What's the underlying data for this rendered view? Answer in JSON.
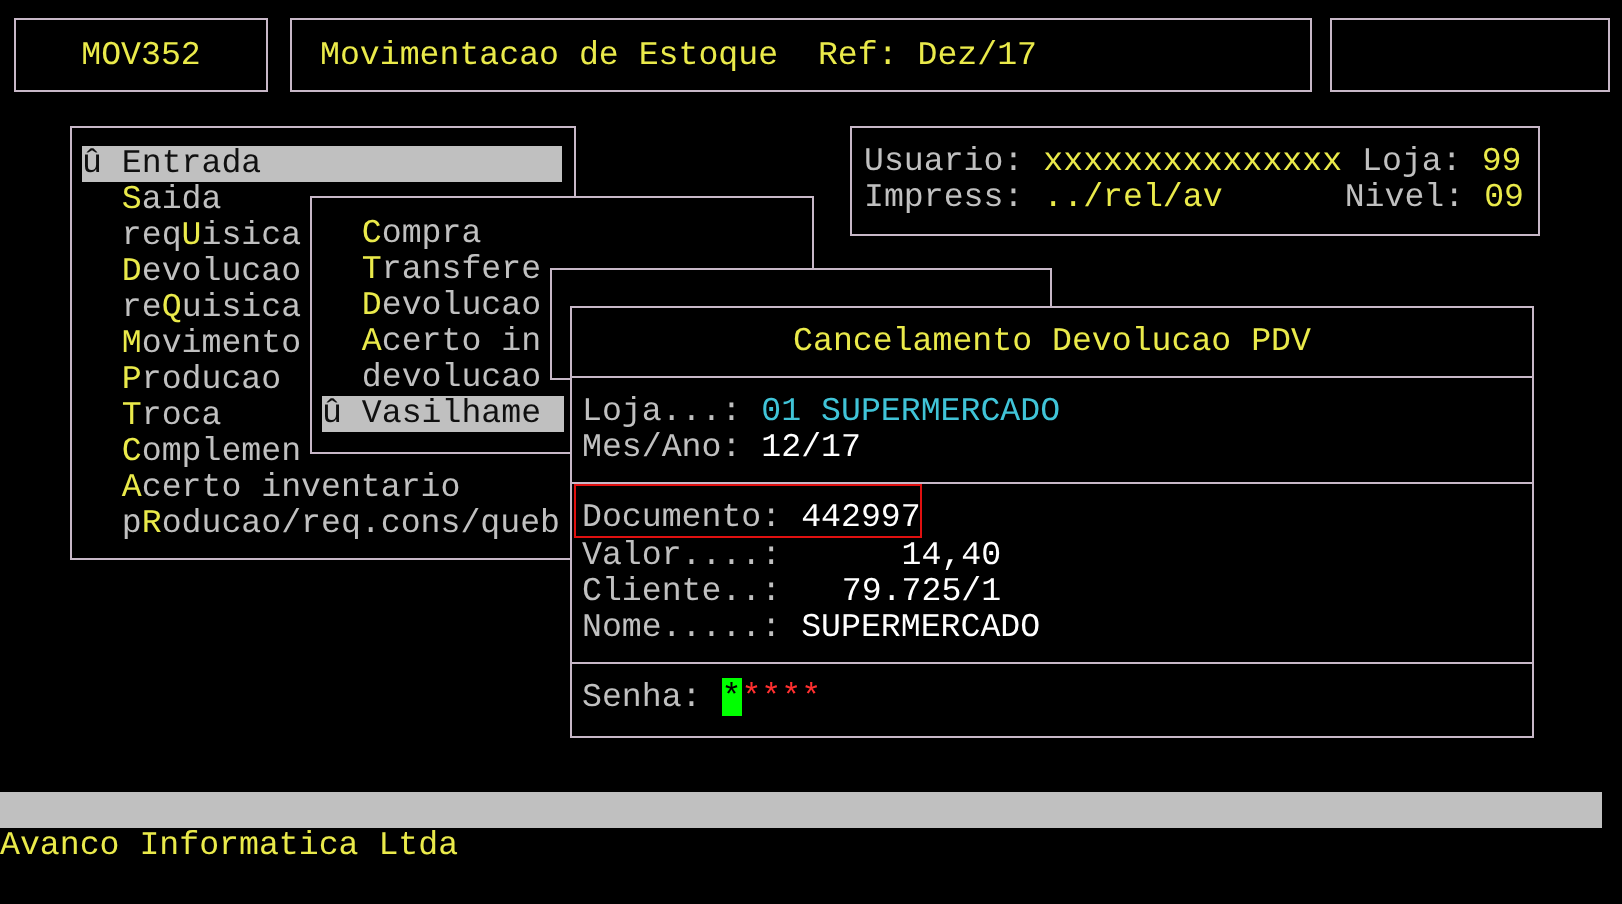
{
  "header": {
    "code": "MOV352",
    "title": "Movimentacao de Estoque  Ref: Dez/17"
  },
  "main_menu": {
    "items": [
      {
        "marker": "û",
        "key": "E",
        "post": "ntrada",
        "selected": true
      },
      {
        "key": "S",
        "post": "aida",
        "selected": false
      },
      {
        "pre": "req",
        "key": "U",
        "post": "isica",
        "selected": false
      },
      {
        "key": "D",
        "post": "evolucao",
        "selected": false
      },
      {
        "pre": "re",
        "key": "Q",
        "post": "uisica",
        "selected": false
      },
      {
        "key": "M",
        "post": "ovimento",
        "selected": false
      },
      {
        "key": "P",
        "post": "roducao",
        "selected": false
      },
      {
        "key": "T",
        "post": "roca",
        "selected": false
      },
      {
        "key": "C",
        "post": "omplemen",
        "selected": false
      },
      {
        "key": "A",
        "post": "certo inventario",
        "selected": false
      },
      {
        "pre": "p",
        "key": "R",
        "post": "oducao/req.cons/queb",
        "selected": false
      }
    ]
  },
  "info": {
    "user_label": "Usuario:",
    "user": "xxxxxxxxxxxxxxx",
    "store_label": "Loja:",
    "store": "99",
    "printer_label": "Impress:",
    "printer": "../rel/av",
    "nivel_label": "Nivel:",
    "nivel": "09"
  },
  "submenu": {
    "items": [
      {
        "key": "C",
        "post": "ompra",
        "selected": false
      },
      {
        "key": "T",
        "post": "ransfere",
        "selected": false
      },
      {
        "key": "D",
        "post": "evolucao",
        "selected": false
      },
      {
        "key": "A",
        "post": "certo in",
        "selected": false
      },
      {
        "pre": "devolucao",
        "selected": false
      },
      {
        "marker": "û",
        "key": "V",
        "post": "asilhame",
        "selected": true
      }
    ]
  },
  "dialog": {
    "title": "Cancelamento Devolucao PDV",
    "store_fields": [
      {
        "label": "Loja...:",
        "value": "01 SUPERMERCADO",
        "kind": "info"
      },
      {
        "label": "Mes/Ano:",
        "value": "12/17",
        "kind": "plain"
      }
    ],
    "doc_fields": [
      {
        "label": "Documento:",
        "value": "442997",
        "kind": "plain",
        "selected": true
      },
      {
        "label": "Valor....:",
        "value": "14,40",
        "kind": "number",
        "selected": false
      },
      {
        "label": "Cliente..:",
        "value": "79.725/1",
        "kind": "number",
        "selected": false
      },
      {
        "label": "Nome.....:",
        "value": "SUPERMERCADO",
        "kind": "plain",
        "selected": false
      }
    ],
    "password": {
      "label": "Senha:",
      "cursor": "*",
      "value": "****"
    }
  },
  "footer": "Avanco Informatica Ltda"
}
